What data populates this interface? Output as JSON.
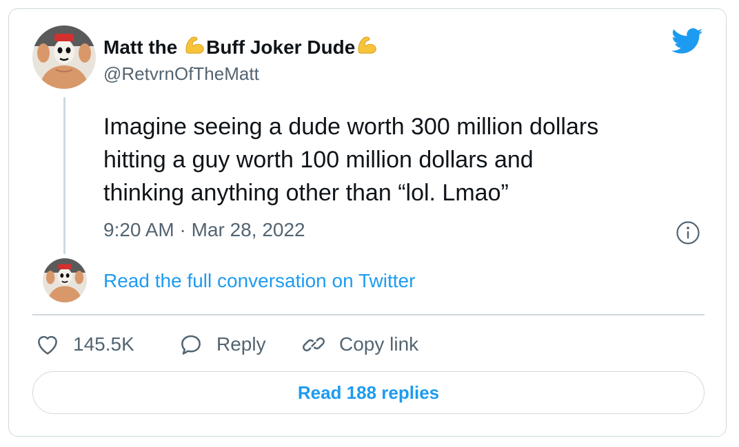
{
  "author": {
    "name_part1": "Matt the ",
    "name_part2": "Buff Joker Dude",
    "name_emoji": "flexed-biceps",
    "handle": "@RetvrnOfTheMatt",
    "avatar_icon": "avatar-image"
  },
  "tweet": {
    "text_lines": [
      "Imagine seeing a dude worth 300 million dollars",
      "hitting a guy worth 100 million dollars and",
      "thinking anything other than “lol. Lmao”"
    ],
    "timestamp": "9:20 AM · Mar 28, 2022"
  },
  "conversation_link": "Read the full conversation on Twitter",
  "actions": {
    "likes": "145.5K",
    "reply_label": "Reply",
    "copy_label": "Copy link"
  },
  "read_replies_label": "Read 188 replies",
  "colors": {
    "accent": "#1d9bf0",
    "text": "#0f1419",
    "secondary": "#536471",
    "border": "#cfd9de"
  },
  "icons": [
    "twitter-bird-icon",
    "info-icon",
    "heart-icon",
    "reply-icon",
    "link-icon"
  ]
}
